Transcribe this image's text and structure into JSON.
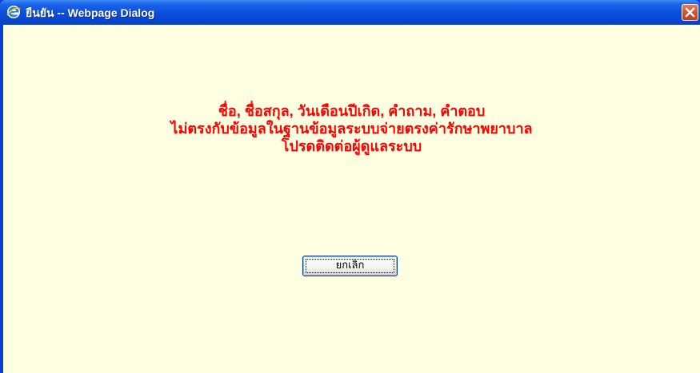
{
  "window": {
    "title": "ยืนยัน -- Webpage Dialog",
    "app_icon": "ie-icon",
    "close_icon": "close-icon"
  },
  "message": {
    "line1": "ชื่อ, ชื่อสกุล, วันเดือนปีเกิด, คำถาม, คำตอบ",
    "line2": "ไม่ตรงกับข้อมูลในฐานข้อมูลระบบจ่ายตรงค่ารักษาพยาบาล",
    "line3": "โปรดติดต่อผู้ดูแลระบบ",
    "color": "#ff0000"
  },
  "buttons": {
    "cancel_label": "ยกเลิก"
  },
  "colors": {
    "background": "#ffffe1",
    "titlebar": "#0a50dc",
    "close": "#d8532c"
  }
}
